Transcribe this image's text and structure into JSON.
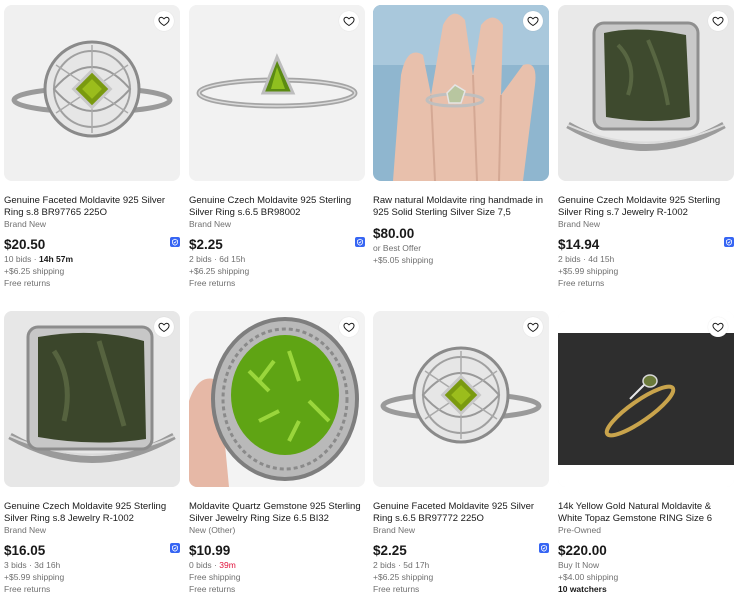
{
  "colors": {
    "accent": "#3665f3",
    "urgent": "#e0103a",
    "muted": "#707070"
  },
  "listings": [
    {
      "title": "Genuine Faceted Moldavite 925 Silver Ring s.8 BR97765 225O",
      "condition": "Brand New",
      "price": "$20.50",
      "bids": "10 bids",
      "sep": "·",
      "time": "14h 57m",
      "shipping": "+$6.25 shipping",
      "returns": "Free returns",
      "icons": [
        "heart-icon",
        "ebay-badge-icon"
      ]
    },
    {
      "title": "Genuine Czech Moldavite 925 Sterling Silver Ring s.6.5 BR98002",
      "condition": "Brand New",
      "price": "$2.25",
      "bids": "2 bids",
      "sep": "·",
      "time": "6d 15h",
      "shipping": "+$6.25 shipping",
      "returns": "Free returns",
      "icons": [
        "heart-icon",
        "ebay-badge-icon"
      ]
    },
    {
      "title": "Raw natural Moldavite ring handmade in 925 Solid Sterling Silver Size 7,5",
      "condition": "",
      "price": "$80.00",
      "offer": "or Best Offer",
      "shipping": "+$5.05 shipping",
      "icons": [
        "heart-icon"
      ]
    },
    {
      "title": "Genuine Czech Moldavite 925 Sterling Silver Ring s.7 Jewelry R-1002",
      "condition": "Brand New",
      "price": "$14.94",
      "bids": "2 bids",
      "sep": "·",
      "time": "4d 15h",
      "shipping": "+$5.99 shipping",
      "returns": "Free returns",
      "icons": [
        "heart-icon",
        "ebay-badge-icon"
      ]
    },
    {
      "title": "Genuine Czech Moldavite 925 Sterling Silver Ring s.8 Jewelry R-1002",
      "condition": "Brand New",
      "price": "$16.05",
      "bids": "3 bids",
      "sep": "·",
      "time": "3d 16h",
      "shipping": "+$5.99 shipping",
      "returns": "Free returns",
      "icons": [
        "heart-icon",
        "ebay-badge-icon"
      ]
    },
    {
      "title": "Moldavite Quartz Gemstone 925 Sterling Silver Jewelry Ring Size 6.5 BI32",
      "condition": "New (Other)",
      "price": "$10.99",
      "bids": "0 bids",
      "sep": "·",
      "time": "39m",
      "shipping": "Free shipping",
      "returns": "Free returns",
      "icons": [
        "heart-icon"
      ]
    },
    {
      "title": "Genuine Faceted Moldavite 925 Silver Ring s.6.5 BR97772 225O",
      "condition": "Brand New",
      "price": "$2.25",
      "bids": "2 bids",
      "sep": "·",
      "time": "5d 17h",
      "shipping": "+$6.25 shipping",
      "returns": "Free returns",
      "icons": [
        "heart-icon",
        "ebay-badge-icon"
      ]
    },
    {
      "title": "14k Yellow Gold Natural Moldavite & White Topaz Gemstone RING Size 6",
      "condition": "Pre-Owned",
      "price": "$220.00",
      "buy": "Buy It Now",
      "shipping": "+$4.00 shipping",
      "watchers": "10 watchers",
      "icons": [
        "heart-icon"
      ]
    }
  ]
}
